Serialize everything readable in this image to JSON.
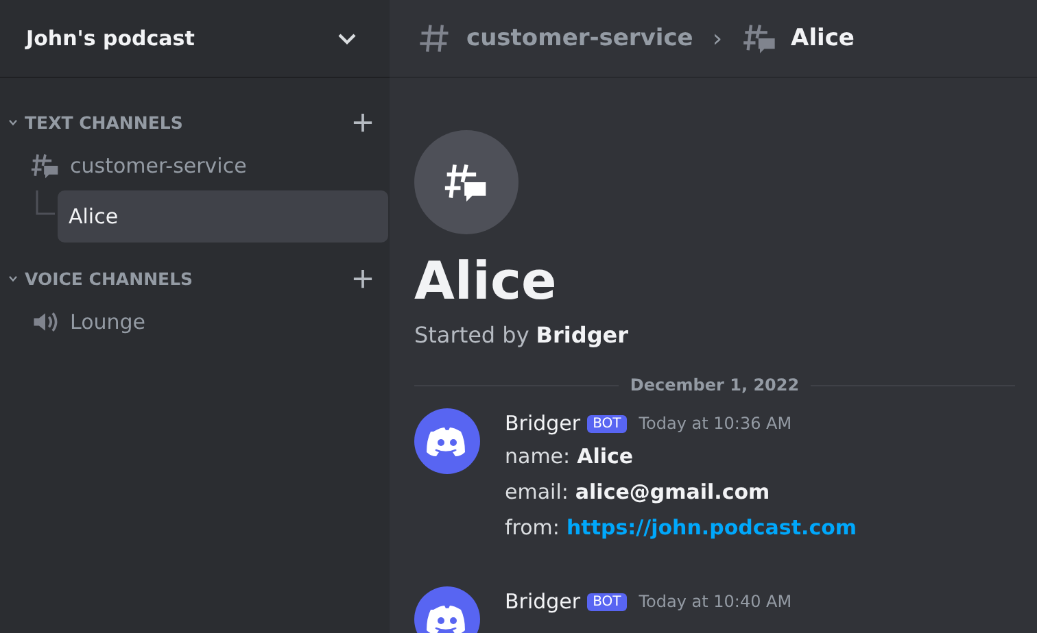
{
  "server": {
    "name": "John's podcast"
  },
  "categories": [
    {
      "name": "TEXT CHANNELS",
      "expanded": true,
      "channels": [
        {
          "name": "customer-service",
          "kind": "forum",
          "selected": false,
          "children": [
            {
              "name": "Alice",
              "selected": true
            }
          ]
        }
      ]
    },
    {
      "name": "VOICE CHANNELS",
      "expanded": true,
      "channels": [
        {
          "name": "Lounge",
          "kind": "voice",
          "selected": false
        }
      ]
    }
  ],
  "breadcrumb": [
    {
      "name": "customer-service",
      "kind": "text"
    },
    {
      "name": "Alice",
      "kind": "forum"
    }
  ],
  "breadcrumb_separator": "›",
  "thread": {
    "title": "Alice",
    "started_by_label": "Started by",
    "started_by": "Bridger"
  },
  "date_divider": "December 1, 2022",
  "messages": [
    {
      "author": "Bridger",
      "badge": "BOT",
      "time": "Today at 10:36 AM",
      "lines": [
        {
          "label": "name:",
          "value": "Alice",
          "kind": "bold"
        },
        {
          "label": "email:",
          "value": "alice@gmail.com",
          "kind": "bold"
        },
        {
          "label": "from:",
          "value": "https://john.podcast.com",
          "kind": "link"
        }
      ]
    },
    {
      "author": "Bridger",
      "badge": "BOT",
      "time": "Today at 10:40 AM"
    }
  ]
}
